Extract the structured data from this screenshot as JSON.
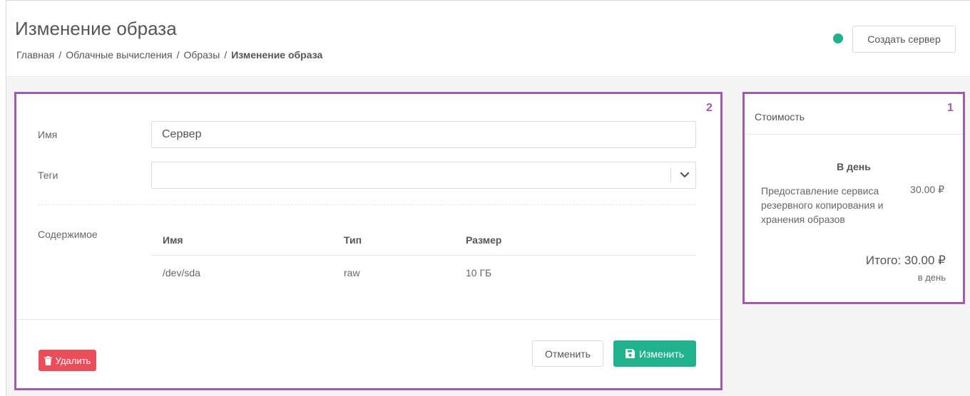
{
  "header": {
    "title": "Изменение образа",
    "breadcrumb": [
      "Главная",
      "Облачные вычисления",
      "Образы",
      "Изменение образа"
    ],
    "breadcrumb_separator": "/",
    "create_server_label": "Создать сервер",
    "status_color": "#1fb28c"
  },
  "form": {
    "panel_number": "2",
    "name_label": "Имя",
    "name_value": "Сервер",
    "tags_label": "Теги",
    "tags_value": "",
    "contents_label": "Содержимое",
    "table": {
      "headers": [
        "Имя",
        "Тип",
        "Размер"
      ],
      "rows": [
        [
          "/dev/sda",
          "raw",
          "10 ГБ"
        ]
      ]
    },
    "delete_label": "Удалить",
    "cancel_label": "Отменить",
    "save_label": "Изменить"
  },
  "cost": {
    "panel_number": "1",
    "title": "Стоимость",
    "period": "В день",
    "service_name": "Предоставление сервиса резервного копирования и хранения образов",
    "service_price": "30.00 ₽",
    "total": "Итого: 30.00 ₽",
    "total_period": "в день"
  },
  "colors": {
    "accent_green": "#1fb28c",
    "danger_red": "#ec4d5a",
    "highlight_purple": "#a05bb0"
  },
  "icons": [
    "chevron-down-icon",
    "trash-icon",
    "save-icon",
    "status-dot-icon"
  ]
}
